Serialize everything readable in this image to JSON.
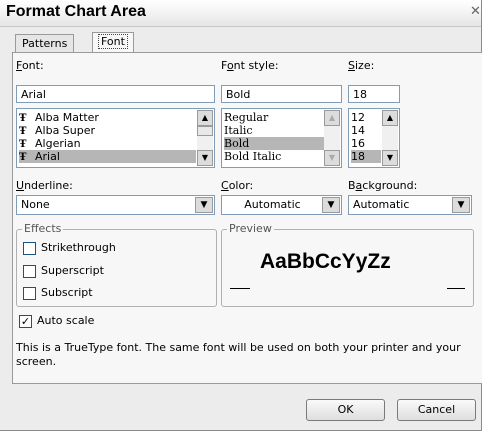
{
  "window": {
    "title": "Format Chart Area"
  },
  "tabs": [
    {
      "label": "Patterns"
    },
    {
      "label": "Font"
    }
  ],
  "font": {
    "label": "Font:",
    "value": "Arial",
    "list": [
      "Alba Matter",
      "Alba Super",
      "Algerian",
      "Arial"
    ],
    "selected": "Arial",
    "icon": "truetype-icon"
  },
  "font_style": {
    "label": "Font style:",
    "value": "Bold",
    "list": [
      "Regular",
      "Italic",
      "Bold",
      "Bold Italic"
    ],
    "selected": "Bold"
  },
  "size": {
    "label": "Size:",
    "value": "18",
    "list": [
      "12",
      "14",
      "16",
      "18"
    ],
    "selected": "18"
  },
  "underline": {
    "label": "Underline:",
    "value": "None"
  },
  "color": {
    "label": "Color:",
    "value": "Automatic"
  },
  "background": {
    "label": "Background:",
    "value": "Automatic"
  },
  "effects": {
    "title": "Effects",
    "strikethrough": {
      "label": "Strikethrough",
      "checked": false
    },
    "superscript": {
      "label": "Superscript",
      "checked": false
    },
    "subscript": {
      "label": "Subscript",
      "checked": false
    }
  },
  "preview": {
    "title": "Preview",
    "sample": "AaBbCcYyZz"
  },
  "auto_scale": {
    "label": "Auto scale",
    "checked": true
  },
  "info": "This is a TrueType font.  The same font will be used on both your printer and your screen.",
  "buttons": {
    "ok": "OK",
    "cancel": "Cancel"
  }
}
